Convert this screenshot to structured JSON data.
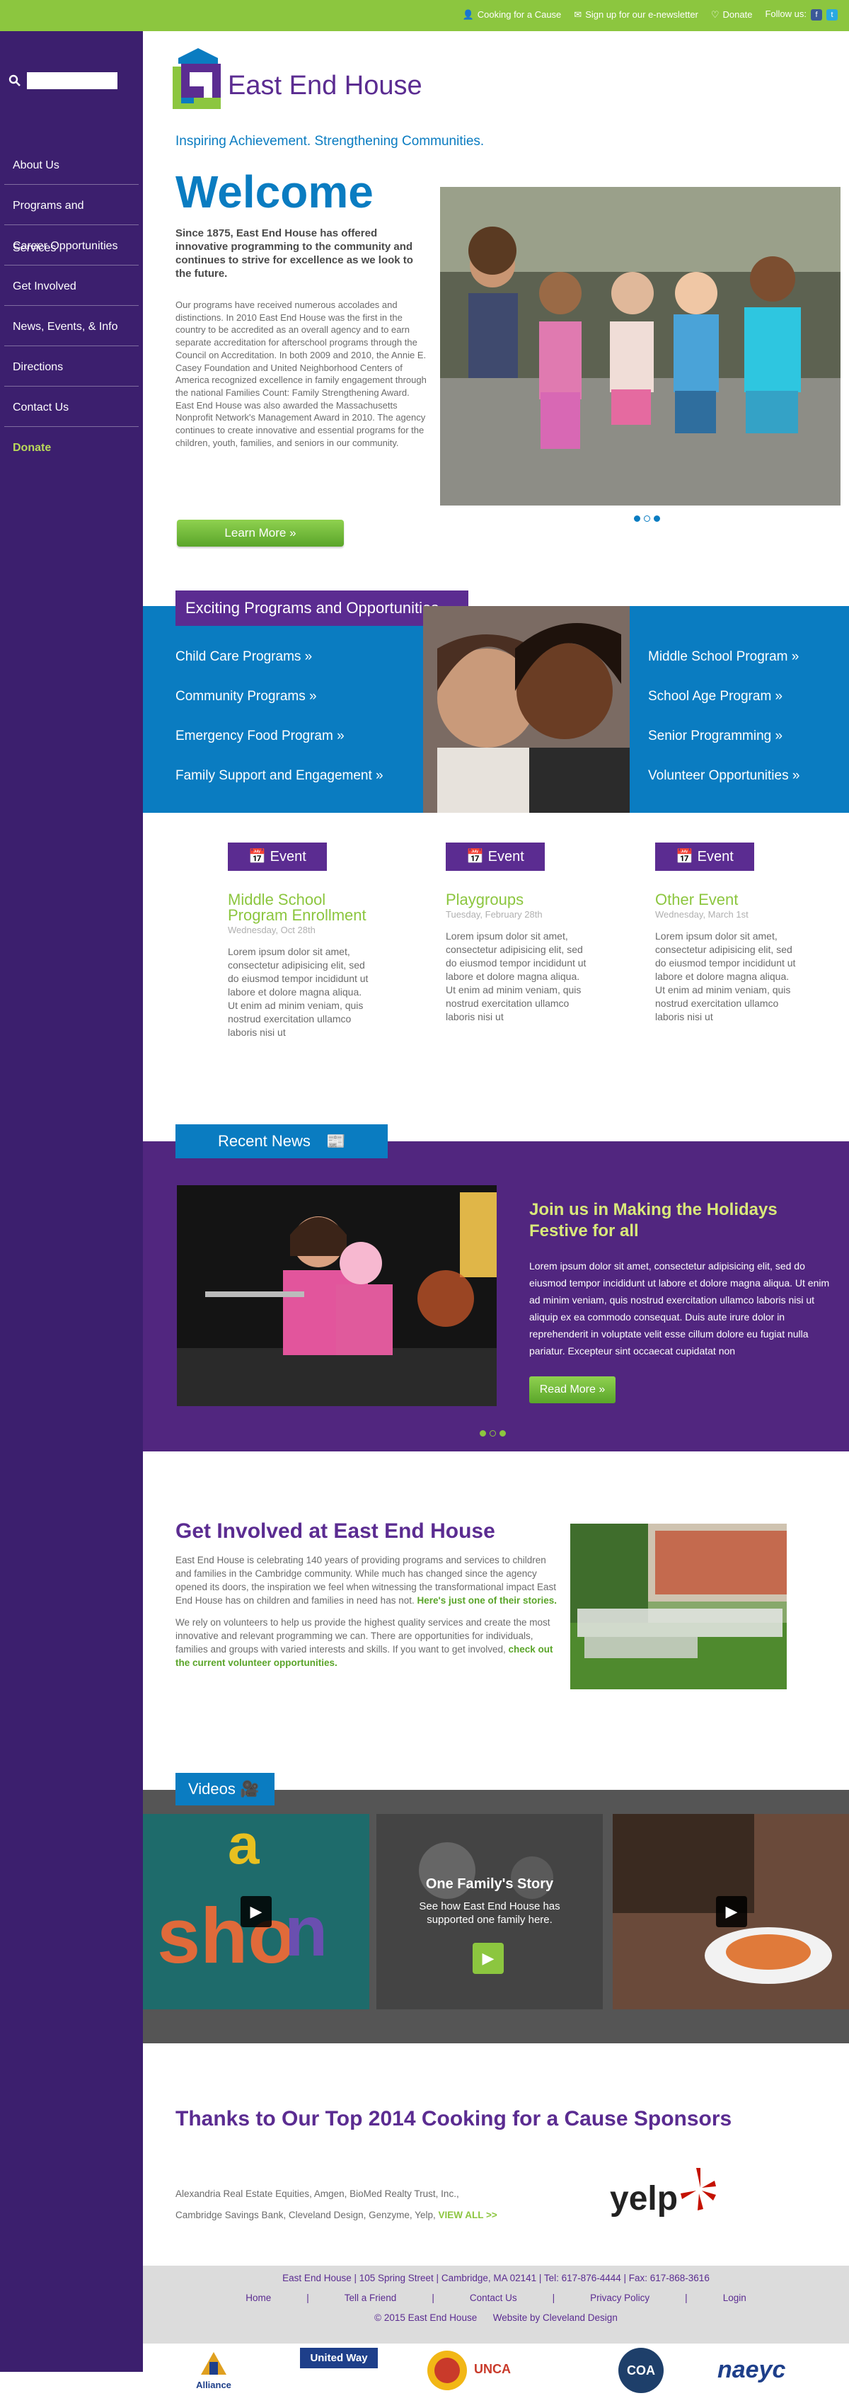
{
  "topbar": {
    "items": [
      "Cooking for a Cause",
      "Sign up for our e-newsletter",
      "Donate",
      "Follow us:"
    ],
    "icons": [
      "person-icon",
      "envelope-icon",
      "heart-icon"
    ],
    "social": [
      "f",
      "t"
    ],
    "color": "#8cc63f"
  },
  "sidebar": {
    "color": "#3c1f6e",
    "search_placeholder": "",
    "nav": [
      "About Us",
      "Programs and Services",
      "Career Opportunities",
      "Get Involved",
      "News, Events, & Info",
      "Directions",
      "Contact Us",
      "Donate"
    ]
  },
  "header": {
    "logo_text": "East End House",
    "tagline": "Inspiring Achievement. Strengthening Communities."
  },
  "welcome": {
    "title": "Welcome",
    "intro": "Since 1875, East End House has offered innovative programming to the community and continues to strive for excellence as we look to the future.",
    "body": "Our programs have received numerous accolades and distinctions. In 2010 East End House was the first in the country to be accredited as an overall agency and to earn separate accreditation for afterschool programs through the Council on Accreditation. In both 2009 and 2010, the Annie E. Casey Foundation and United Neighborhood Centers of America recognized excellence in family engagement through the national Families Count: Family Strengthening Award. East End House was also awarded the Massachusetts Nonprofit Network's Management Award in 2010. The agency continues to create innovative and essential programs for the children, youth, families, and seniors in our community.",
    "button": "Learn More",
    "slide_index": 1,
    "slide_count": 3
  },
  "programs": {
    "title": "Exciting Programs and Opportunities",
    "left": [
      "Child Care Programs",
      "Community Programs",
      "Emergency Food Program",
      "Family Support and Engagement"
    ],
    "right": [
      "Middle School Program",
      "School Age Program",
      "Senior Programming",
      "Volunteer Opportunities"
    ]
  },
  "events": [
    {
      "label": "Event",
      "title": "Middle School Program Enrollment",
      "date": "Wednesday, Oct 28th",
      "text": "Lorem ipsum dolor sit amet, consectetur adipisicing elit, sed do eiusmod tempor incididunt ut labore et dolore magna aliqua. Ut enim ad minim veniam, quis nostrud exercitation ullamco laboris nisi ut"
    },
    {
      "label": "Event",
      "title": "Playgroups",
      "date": "Tuesday, February 28th",
      "text": "Lorem ipsum dolor sit amet, consectetur adipisicing elit, sed do eiusmod tempor incididunt ut labore et dolore magna aliqua. Ut enim ad minim veniam, quis nostrud exercitation ullamco laboris nisi ut"
    },
    {
      "label": "Event",
      "title": "Other Event",
      "date": "Wednesday, March 1st",
      "text": "Lorem ipsum dolor sit amet, consectetur adipisicing elit, sed do eiusmod tempor incididunt ut labore et dolore magna aliqua. Ut enim ad minim veniam, quis nostrud exercitation ullamco laboris nisi ut"
    }
  ],
  "news": {
    "title": "Recent News",
    "headline": "Join us in Making the Holidays Festive for all",
    "body": "Lorem ipsum dolor sit amet, consectetur adipisicing elit, sed do eiusmod tempor incididunt ut labore et dolore magna aliqua. Ut enim ad minim veniam, quis nostrud exercitation ullamco laboris nisi ut aliquip ex ea commodo consequat. Duis aute irure dolor in reprehenderit in voluptate velit esse cillum dolore eu fugiat nulla pariatur. Excepteur sint occaecat cupidatat non",
    "button": "Read More",
    "slide_index": 1,
    "slide_count": 3
  },
  "get_involved": {
    "title": "Get Involved at East End House",
    "p1": "East End House is celebrating 140 years of providing programs and services to children and families in the Cambridge community. While much has changed since the agency opened its doors, the inspiration we feel when witnessing the transformational impact East End House has on children and families in need has not.",
    "p1_link": "Here's just one of their stories.",
    "p2": "We rely on volunteers to help us provide the highest quality services and create the most innovative and relevant programming we can. There are opportunities for individuals, families and groups with varied interests and skills. If you want to get involved,",
    "p2_link": "check out the current volunteer opportunities."
  },
  "videos": {
    "title": "Videos",
    "feature_title": "One Family's Story",
    "feature_text": "See how East End House has supported one family here."
  },
  "sponsors": {
    "title": "Thanks to Our Top 2014 Cooking for a Cause Sponsors",
    "line1": "Alexandria Real Estate Equities, Amgen, BioMed Realty Trust, Inc.,",
    "line2": "Cambridge Savings Bank, Cleveland Design, Genzyme, Yelp,",
    "link": "VIEW ALL >>",
    "yelp": "yelp"
  },
  "footer": {
    "address": "East End House | 105 Spring Street | Cambridge, MA 02141 | Tel: 617-876-4444 | Fax: 617-868-3616",
    "links": [
      "Home",
      "|",
      "Tell a Friend",
      "|",
      "Contact Us",
      "|",
      "Privacy Policy",
      "|",
      "Login"
    ],
    "copyright": "© 2015 East End House",
    "credit": "Website by Cleveland Design",
    "logos": [
      "Alliance",
      "United Way",
      "UNCA",
      "COA",
      "naeyc"
    ]
  }
}
